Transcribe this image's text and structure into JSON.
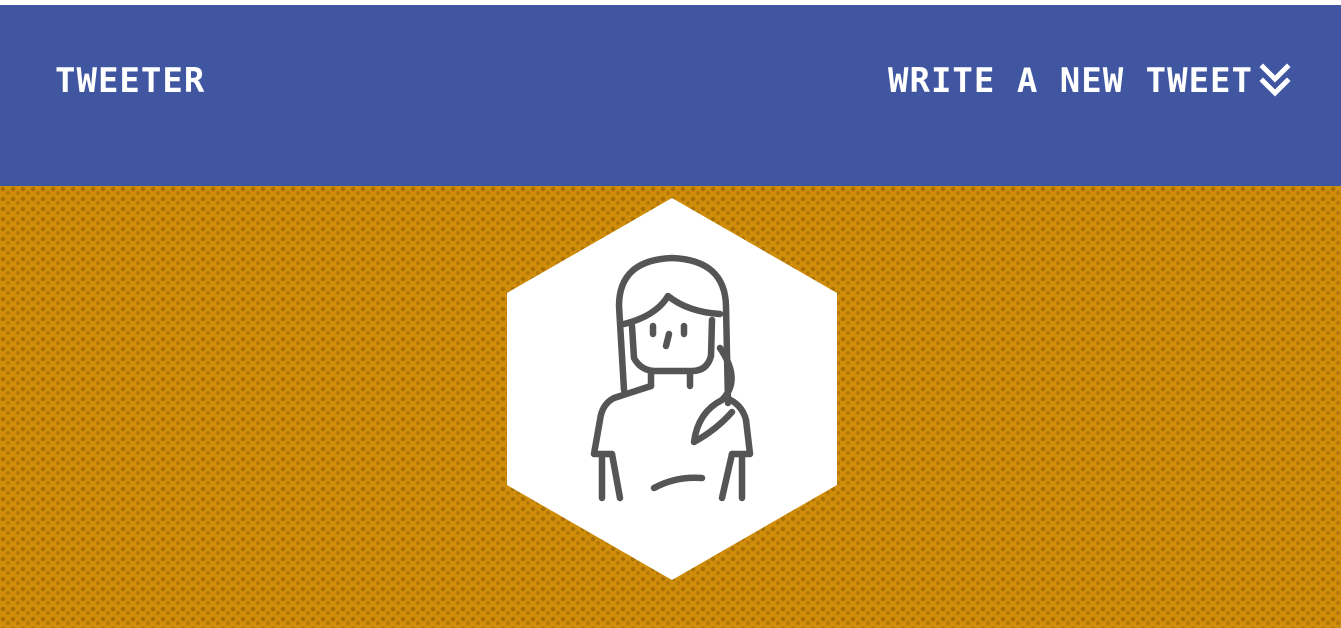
{
  "header": {
    "brand": "TWEETER",
    "compose_label": "WRITE A NEW TWEET",
    "compose_icon": "double-chevron-down-icon"
  },
  "profile": {
    "avatar_icon": "user-avatar-icon"
  },
  "colors": {
    "navbar": "#4056a1",
    "hero_texture": "#d08e0a",
    "text": "#ffffff",
    "avatar_line": "#555555"
  }
}
